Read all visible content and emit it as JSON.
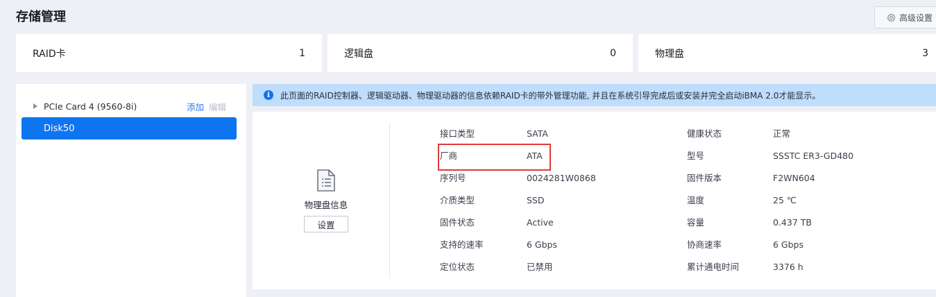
{
  "header": {
    "title": "存储管理",
    "advanced_settings_label": "高级设置"
  },
  "summary": [
    {
      "label": "RAID卡",
      "value": "1"
    },
    {
      "label": "逻辑盘",
      "value": "0"
    },
    {
      "label": "物理盘",
      "value": "3"
    }
  ],
  "tree": {
    "controller_label": "PCIe Card 4 (9560-8i)",
    "add_label": "添加",
    "edit_label": "编辑",
    "selected_item": "Disk50"
  },
  "notice": {
    "text": "此页面的RAID控制器、逻辑驱动器、物理驱动器的信息依赖RAID卡的带外管理功能, 并且在系统引导完成后或安装并完全启动iBMA 2.0才能显示。"
  },
  "disk_info": {
    "caption": "物理盘信息",
    "settings_button": "设置",
    "left_fields": [
      {
        "label": "接口类型",
        "value": "SATA"
      },
      {
        "label": "厂商",
        "value": "ATA"
      },
      {
        "label": "序列号",
        "value": "0024281W0868"
      },
      {
        "label": "介质类型",
        "value": "SSD"
      },
      {
        "label": "固件状态",
        "value": "Active"
      },
      {
        "label": "支持的速率",
        "value": "6 Gbps"
      },
      {
        "label": "定位状态",
        "value": "已禁用"
      }
    ],
    "right_fields": [
      {
        "label": "健康状态",
        "value": "正常"
      },
      {
        "label": "型号",
        "value": "SSSTC ER3-GD480"
      },
      {
        "label": "固件版本",
        "value": "F2WN604"
      },
      {
        "label": "温度",
        "value": "25 ℃"
      },
      {
        "label": "容量",
        "value": "0.437 TB"
      },
      {
        "label": "协商速率",
        "value": "6 Gbps"
      },
      {
        "label": "累计通电时间",
        "value": "3376 h"
      }
    ]
  },
  "colors": {
    "accent": "#0f74f0",
    "notice_bg": "#bfddfc",
    "highlight": "#e03a3a"
  }
}
